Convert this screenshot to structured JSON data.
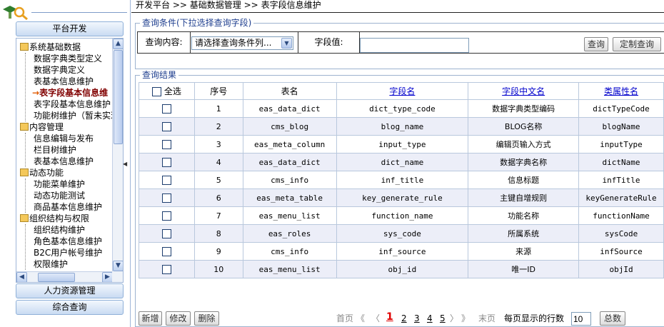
{
  "breadcrumb": {
    "root": "开发平台",
    "level2": "基础数据管理",
    "current": "表字段信息维护",
    "sep": ">>"
  },
  "sidebar": {
    "groups": [
      "平台开发",
      "人力资源管理",
      "综合查询"
    ],
    "tree": {
      "g1": "系统基础数据",
      "g1_items": [
        "数据字典类型定义",
        "数据字典定义",
        "表基本信息维护",
        "表字段基本信息维",
        "表字段基本信息维护",
        "功能树维护（暂未实现"
      ],
      "g2": "内容管理",
      "g2_items": [
        "信息编辑与发布",
        "栏目树维护",
        "表基本信息维护"
      ],
      "g3": "动态功能",
      "g3_items": [
        "功能菜单维护",
        "动态功能测试",
        "商品基本信息维护"
      ],
      "g4": "组织结构与权限",
      "g4_items": [
        "组织结构维护",
        "角色基本信息维护",
        "B2C用户帐号维护",
        "权限维护"
      ]
    }
  },
  "query": {
    "title": "查询条件(下拉选择查询字段)",
    "content_label": "查询内容:",
    "select_value": "请选择查询条件列...",
    "field_label": "字段值:",
    "field_value": "",
    "search_btn": "查询",
    "custom_btn": "定制查询"
  },
  "results": {
    "title": "查询结果",
    "columns": [
      "全选",
      "序号",
      "表名",
      "字段名",
      "字段中文名",
      "类属性名"
    ],
    "rows": [
      [
        "1",
        "eas_data_dict",
        "dict_type_code",
        "数据字典类型编码",
        "dictTypeCode"
      ],
      [
        "2",
        "cms_blog",
        "blog_name",
        "BLOG名称",
        "blogName"
      ],
      [
        "3",
        "eas_meta_column",
        "input_type",
        "编辑页输入方式",
        "inputType"
      ],
      [
        "4",
        "eas_data_dict",
        "dict_name",
        "数据字典名称",
        "dictName"
      ],
      [
        "5",
        "cms_info",
        "inf_title",
        "信息标题",
        "infTitle"
      ],
      [
        "6",
        "eas_meta_table",
        "key_generate_rule",
        "主键自增规则",
        "keyGenerateRule"
      ],
      [
        "7",
        "eas_menu_list",
        "function_name",
        "功能名称",
        "functionName"
      ],
      [
        "8",
        "eas_roles",
        "sys_code",
        "所属系统",
        "sysCode"
      ],
      [
        "9",
        "cms_info",
        "inf_source",
        "来源",
        "infSource"
      ],
      [
        "10",
        "eas_menu_list",
        "obj_id",
        "唯一ID",
        "objId"
      ]
    ]
  },
  "pager": {
    "add": "新增",
    "edit": "修改",
    "delete": "删除",
    "first": "首页",
    "prev_more": "《",
    "prev": "〈",
    "pages": [
      "1",
      "2",
      "3",
      "4",
      "5"
    ],
    "next": "〉",
    "next_more": "》",
    "last": "末页",
    "rows_label": "每页显示的行数",
    "page_size": "10",
    "total": "总数"
  }
}
